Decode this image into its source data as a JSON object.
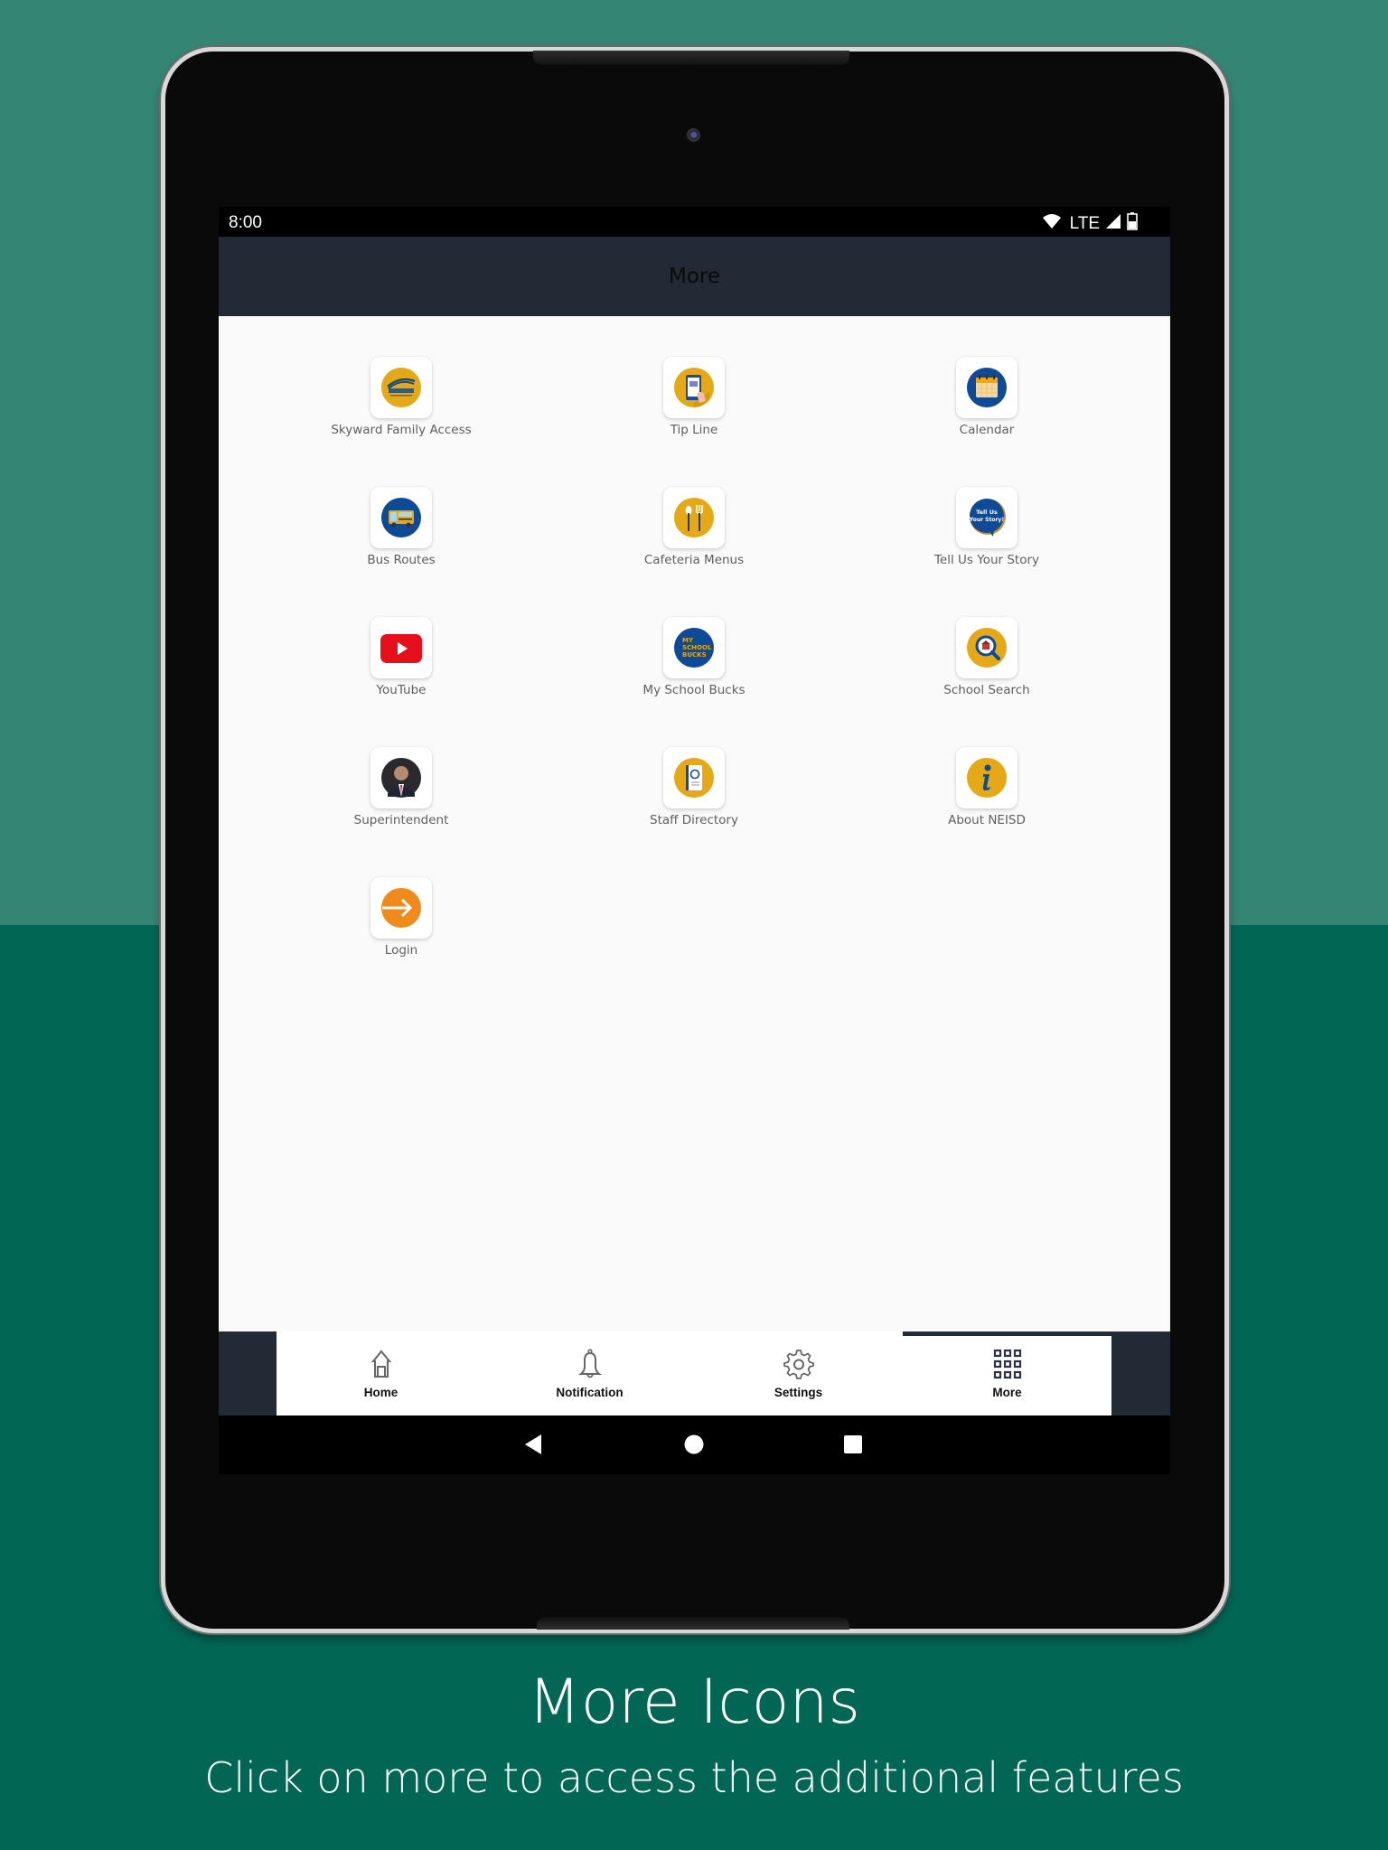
{
  "status_bar": {
    "time": "8:00",
    "network": "LTE",
    "icons": [
      "wifi-icon",
      "cell-signal-icon",
      "battery-icon"
    ]
  },
  "header": {
    "title": "More"
  },
  "grid_items": [
    {
      "label": "Skyward Family Access",
      "icon": "skyward-icon"
    },
    {
      "label": "Tip Line",
      "icon": "tip-line-icon"
    },
    {
      "label": "Calendar",
      "icon": "calendar-icon"
    },
    {
      "label": "Bus Routes",
      "icon": "bus-icon"
    },
    {
      "label": "Cafeteria Menus",
      "icon": "utensils-icon"
    },
    {
      "label": "Tell Us Your Story",
      "icon": "speech-bubble-icon",
      "badge_text_1": "Tell Us",
      "badge_text_2": "Your Story!"
    },
    {
      "label": "YouTube",
      "icon": "youtube-icon"
    },
    {
      "label": "My School Bucks",
      "icon": "school-bucks-icon",
      "badge_text_1": "MY",
      "badge_text_2": "SCHOOL",
      "badge_text_3": "BUCKS"
    },
    {
      "label": "School Search",
      "icon": "school-search-icon"
    },
    {
      "label": "Superintendent",
      "icon": "superintendent-photo-icon"
    },
    {
      "label": "Staff Directory",
      "icon": "address-book-icon"
    },
    {
      "label": "About NEISD",
      "icon": "info-icon"
    },
    {
      "label": "Login",
      "icon": "login-arrow-icon"
    }
  ],
  "tabbar": {
    "active": "More",
    "tabs": [
      {
        "label": "Home",
        "icon": "home-icon"
      },
      {
        "label": "Notification",
        "icon": "bell-icon"
      },
      {
        "label": "Settings",
        "icon": "gear-icon"
      },
      {
        "label": "More",
        "icon": "grid-icon"
      }
    ]
  },
  "nav": {
    "buttons": [
      "back-icon",
      "home-circle-icon",
      "recents-icon"
    ]
  },
  "caption": {
    "title": "More Icons",
    "subtitle": "Click on more to access the additional features"
  },
  "colors": {
    "header_bg": "#222a36",
    "bg_top": "#358574",
    "bg_bottom": "#016654",
    "gold": "#e5a918",
    "navy": "#0e4a96",
    "orange": "#f08a1c",
    "youtube_red": "#e5101c"
  }
}
